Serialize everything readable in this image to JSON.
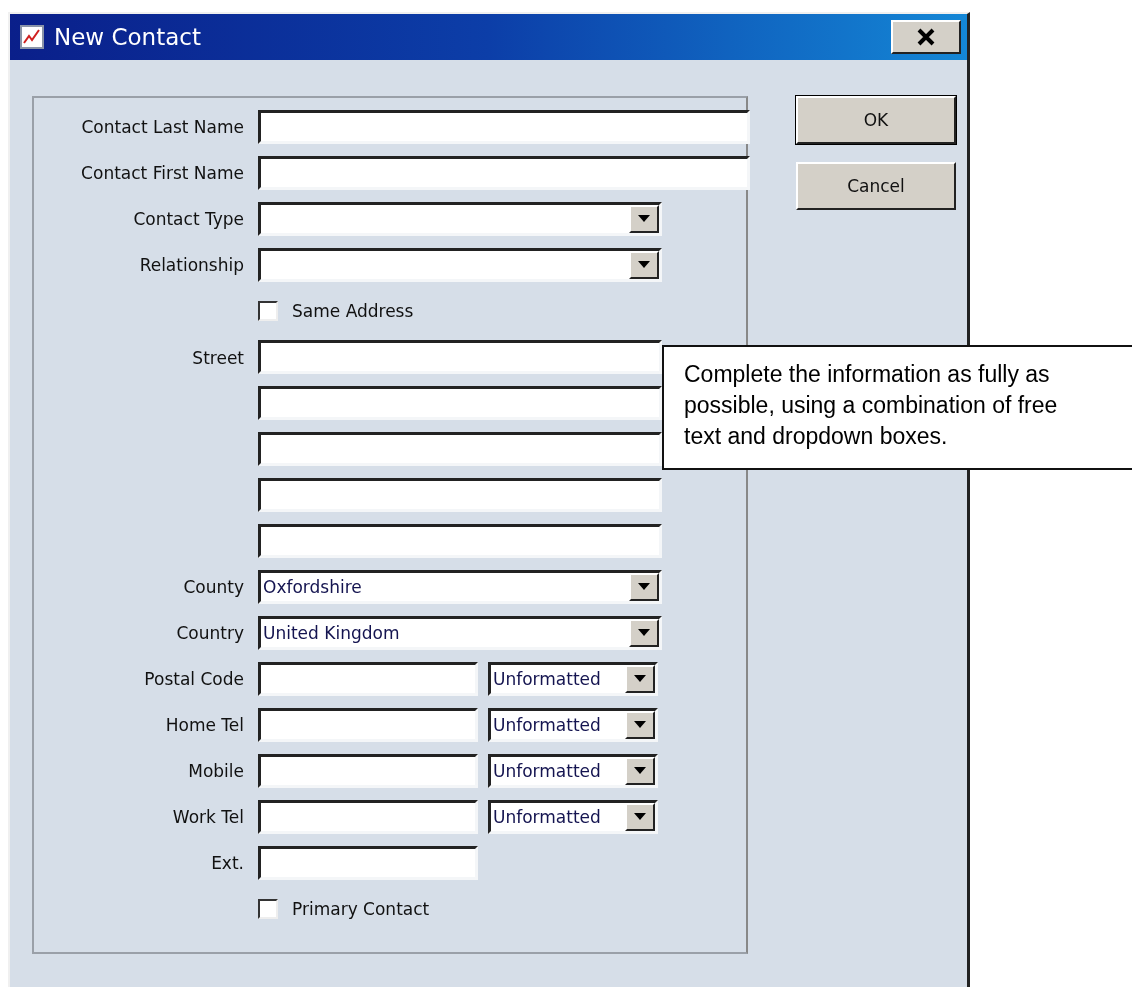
{
  "window": {
    "title": "New Contact"
  },
  "form": [
    {
      "kind": "text",
      "label": "Contact Last Name"
    },
    {
      "kind": "text",
      "label": "Contact First Name"
    },
    {
      "kind": "dropdown",
      "label": "Contact Type"
    },
    {
      "kind": "dropdown",
      "label": "Relationship"
    },
    {
      "kind": "checkbox",
      "label": "Same Address",
      "checked": false
    },
    {
      "kind": "address",
      "label": "Street"
    },
    {
      "kind": "dropdown",
      "label": "County",
      "value": "Oxfordshire"
    },
    {
      "kind": "dropdown",
      "label": "Country",
      "value": "United Kingdom"
    },
    {
      "kind": "formatted",
      "label": "Postal Code",
      "format": "Unformatted"
    },
    {
      "kind": "formatted",
      "label": "Home Tel",
      "format": "Unformatted"
    },
    {
      "kind": "formatted",
      "label": "Mobile",
      "format": "Unformatted"
    },
    {
      "kind": "formatted",
      "label": "Work Tel",
      "format": "Unformatted"
    },
    {
      "kind": "short",
      "label": "Ext."
    },
    {
      "kind": "checkbox",
      "label": "Primary Contact",
      "checked": false
    }
  ],
  "buttons": [
    "OK",
    "Cancel"
  ],
  "callout": "Complete the information as fully as possible, using a combination of free text and dropdown boxes."
}
